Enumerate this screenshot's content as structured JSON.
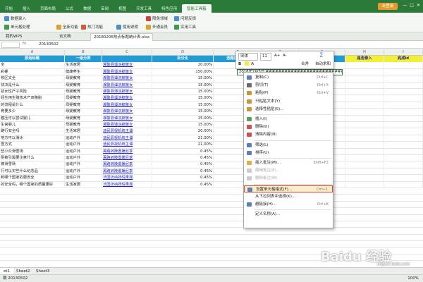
{
  "ribbon_tabs": [
    "开始",
    "插入",
    "页面布局",
    "公式",
    "数据",
    "审阅",
    "视图",
    "开发工具",
    "特色应用",
    "智能工具箱"
  ],
  "active_tab": "智能工具箱",
  "login_label": "未登录",
  "window_controls": [
    "—",
    "□",
    "✕"
  ],
  "ribbon": {
    "btn1": "数据录入",
    "btn2": "单元格处理",
    "btn3": "全新功能",
    "btn4": "热门功能",
    "btn5": "使用说明",
    "btn6": "限免领域",
    "btn7": "问题反馈",
    "btn8": "开通会员",
    "btn9": "实用工具"
  },
  "doc_tabs": [
    "我的WPS",
    "云文档",
    "20180205热点标题统计表.xlsx"
  ],
  "formula_bar": {
    "cell_ref": "",
    "fx": "fx",
    "value": "20130502"
  },
  "columns": [
    "A",
    "B",
    "C",
    "D",
    "E",
    "F",
    "G",
    "H",
    "I"
  ],
  "header_row": [
    "原始标题",
    "一级分类",
    "",
    "百分比",
    "选题推百分比",
    "",
    "",
    "是否录入",
    "完成id"
  ],
  "rows": [
    [
      "全",
      "生活家居",
      "湘警县谭浣航敬女",
      "20.00%",
      "0.3"
    ],
    [
      "彩螺",
      "健康养生",
      "湘警县谭浣航敬女",
      "150.00%",
      "1.5"
    ],
    [
      "校区文全",
      "母婴教育",
      "湘警县谭浣航敬女",
      "15.00%",
      "0.15"
    ],
    [
      "快决是什么",
      "母婴教育",
      "湘警县谭浣航敬女",
      "15.00%",
      "0.15"
    ],
    [
      "孩女性产子风险",
      "母婴教育",
      "湘警县谭浣航敬女",
      "15.00%",
      "0.15"
    ],
    [
      "经生用生殖技术产双胞胎",
      "母婴教育",
      "湘警县谭浣航敬女",
      "15.00%",
      "0.15"
    ],
    [
      "的流程是什么",
      "母婴教育",
      "湘警县谭浣航敬女",
      "15.00%",
      "0.15"
    ],
    [
      "育要多少",
      "母婴教育",
      "湘警县谭浣航敬女",
      "15.00%",
      "0.15"
    ],
    [
      "腹压可以尝试婴儿",
      "母婴教育",
      "湘警县谭浣航敬女",
      "15.00%",
      "0.15"
    ],
    [
      "生宫婴儿",
      "母婴教育",
      "湘警县谭浣航敬女",
      "15.00%",
      "0.15"
    ],
    [
      "路行安全吗",
      "生活家居",
      "迪民辰视机统主谭",
      "20.00%",
      "0.2"
    ],
    [
      "地方可以滑冰",
      "运动户外",
      "迪民辰视机统主谭",
      "21.00%",
      "0.21"
    ],
    [
      "雪方式",
      "运动户外",
      "迪民辰视机统主谭",
      "21.00%",
      "0.21"
    ],
    [
      "些小众滑雪场",
      "运动户外",
      "萬路转陵置媛尼季",
      "0.45%",
      "0.0045"
    ],
    [
      "阴被引需要注意什么",
      "运动户外",
      "萬路转陵置媛尼季",
      "0.45%",
      "0.0045"
    ],
    [
      "被滑雪场",
      "运动户外",
      "萬路转陵置媛尼季",
      "0.45%",
      "0.0045"
    ],
    [
      "行可以买些什么纪念品",
      "运动户外",
      "萬路转陵置媛尼季",
      "0.45%",
      "0.0045"
    ],
    [
      "和哪个国家的更安全",
      "运动户外",
      "法国扮纳扬悦果属",
      "0.45%",
      "0.0045"
    ],
    [
      "的安全吗，哪个国家的质量更好",
      "生活家居",
      "法国扮纳扬悦果属",
      "0.45%",
      "0.0045"
    ]
  ],
  "edit_cell_value": "2018年2月5日 ############################",
  "mini_toolbar": {
    "font": "宋体",
    "size": "11",
    "grow": "A+",
    "shrink": "A-",
    "bold": "B",
    "sum_label": "合并",
    "autosum_label": "自动求和"
  },
  "context_menu": [
    {
      "label": "复制(C)",
      "shortcut": "Ctrl+C",
      "icon_color": "#5a7fb8"
    },
    {
      "label": "剪切(T)",
      "shortcut": "Ctrl+X",
      "icon_color": "#6a6a6a"
    },
    {
      "label": "粘贴(P)",
      "shortcut": "Ctrl+V",
      "icon_color": "#c9963a"
    },
    {
      "label": "只粘贴文本(Y)",
      "shortcut": "",
      "icon_color": "#c9963a"
    },
    {
      "label": "选择性粘贴(S)...",
      "shortcut": "",
      "icon_color": "#c9963a"
    },
    {
      "label": "插入(I)",
      "shortcut": "",
      "icon_color": "#5a9f5a"
    },
    {
      "label": "删除(D)",
      "shortcut": "",
      "icon_color": "#d05050"
    },
    {
      "label": "清除内容(N)",
      "shortcut": "",
      "icon_color": "#d05050"
    },
    {
      "label": "筛选(L)",
      "shortcut": "",
      "icon_color": "#5a7fb8"
    },
    {
      "label": "排序(U)",
      "shortcut": "",
      "icon_color": "#5a7fb8"
    },
    {
      "label": "插入批注(M)...",
      "shortcut": "Shift+F2",
      "icon_color": "#e0b040"
    },
    {
      "label": "编辑批注(E)...",
      "shortcut": "",
      "icon_color": "#cccccc"
    },
    {
      "label": "删除批注(M)",
      "shortcut": "",
      "icon_color": "#cccccc"
    },
    {
      "label": "设置单元格格式(F)...",
      "shortcut": "Ctrl+1",
      "icon_color": "#5a7fb8"
    },
    {
      "label": "从下拉列表中选择(K)...",
      "shortcut": "",
      "icon_color": "#ffffff"
    },
    {
      "label": "超链接(H)...",
      "shortcut": "Ctrl+K",
      "icon_color": "#5a7fb8"
    },
    {
      "label": "定义名称(A)...",
      "shortcut": "",
      "icon_color": "#ffffff"
    }
  ],
  "sheet_tabs": [
    "et1",
    "Sheet2",
    "Sheet3"
  ],
  "status_text": "期 20130502",
  "zoom_label": "100%",
  "watermark": "Baidu 经验",
  "watermark_url": "jingyan.baidu.com",
  "colors": {
    "header_blue": "#1f9bd6",
    "header_yellow": "#f2ef35",
    "ribbon_green": "#2b7a3a",
    "highlight": "#d9482b"
  }
}
